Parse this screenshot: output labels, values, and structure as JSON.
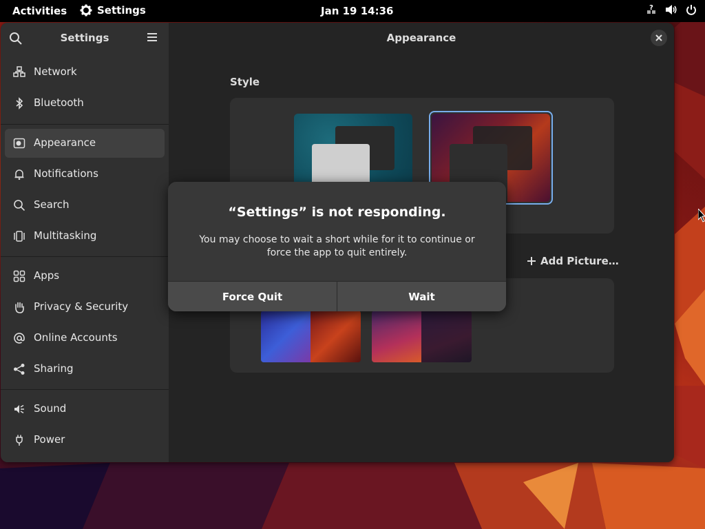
{
  "topbar": {
    "activities": "Activities",
    "app_name": "Settings",
    "clock": "Jan 19  14:36",
    "icons": [
      "network-unknown-icon",
      "volume-icon",
      "power-icon"
    ]
  },
  "sidebar": {
    "title": "Settings",
    "items": [
      {
        "label": "Network",
        "icon": "network-icon"
      },
      {
        "label": "Bluetooth",
        "icon": "bluetooth-icon"
      },
      {
        "label": "Appearance",
        "icon": "appearance-icon",
        "active": true
      },
      {
        "label": "Notifications",
        "icon": "bell-icon"
      },
      {
        "label": "Search",
        "icon": "search-icon"
      },
      {
        "label": "Multitasking",
        "icon": "multitasking-icon"
      },
      {
        "label": "Apps",
        "icon": "apps-grid-icon"
      },
      {
        "label": "Privacy & Security",
        "icon": "hand-icon"
      },
      {
        "label": "Online Accounts",
        "icon": "at-icon"
      },
      {
        "label": "Sharing",
        "icon": "share-icon"
      },
      {
        "label": "Sound",
        "icon": "speaker-icon"
      },
      {
        "label": "Power",
        "icon": "power-plug-icon"
      }
    ]
  },
  "main": {
    "title": "Appearance",
    "style_label": "Style",
    "add_picture": "Add Picture…"
  },
  "dialog": {
    "title": "“Settings” is not responding.",
    "body": "You may choose to wait a short while for it to continue or force the app to quit entirely.",
    "force_quit": "Force Quit",
    "wait": "Wait"
  },
  "colors": {
    "accent": "#78aeed",
    "window_bg": "#242424",
    "sidebar_bg": "#303030",
    "dialog_bg": "#383838"
  }
}
